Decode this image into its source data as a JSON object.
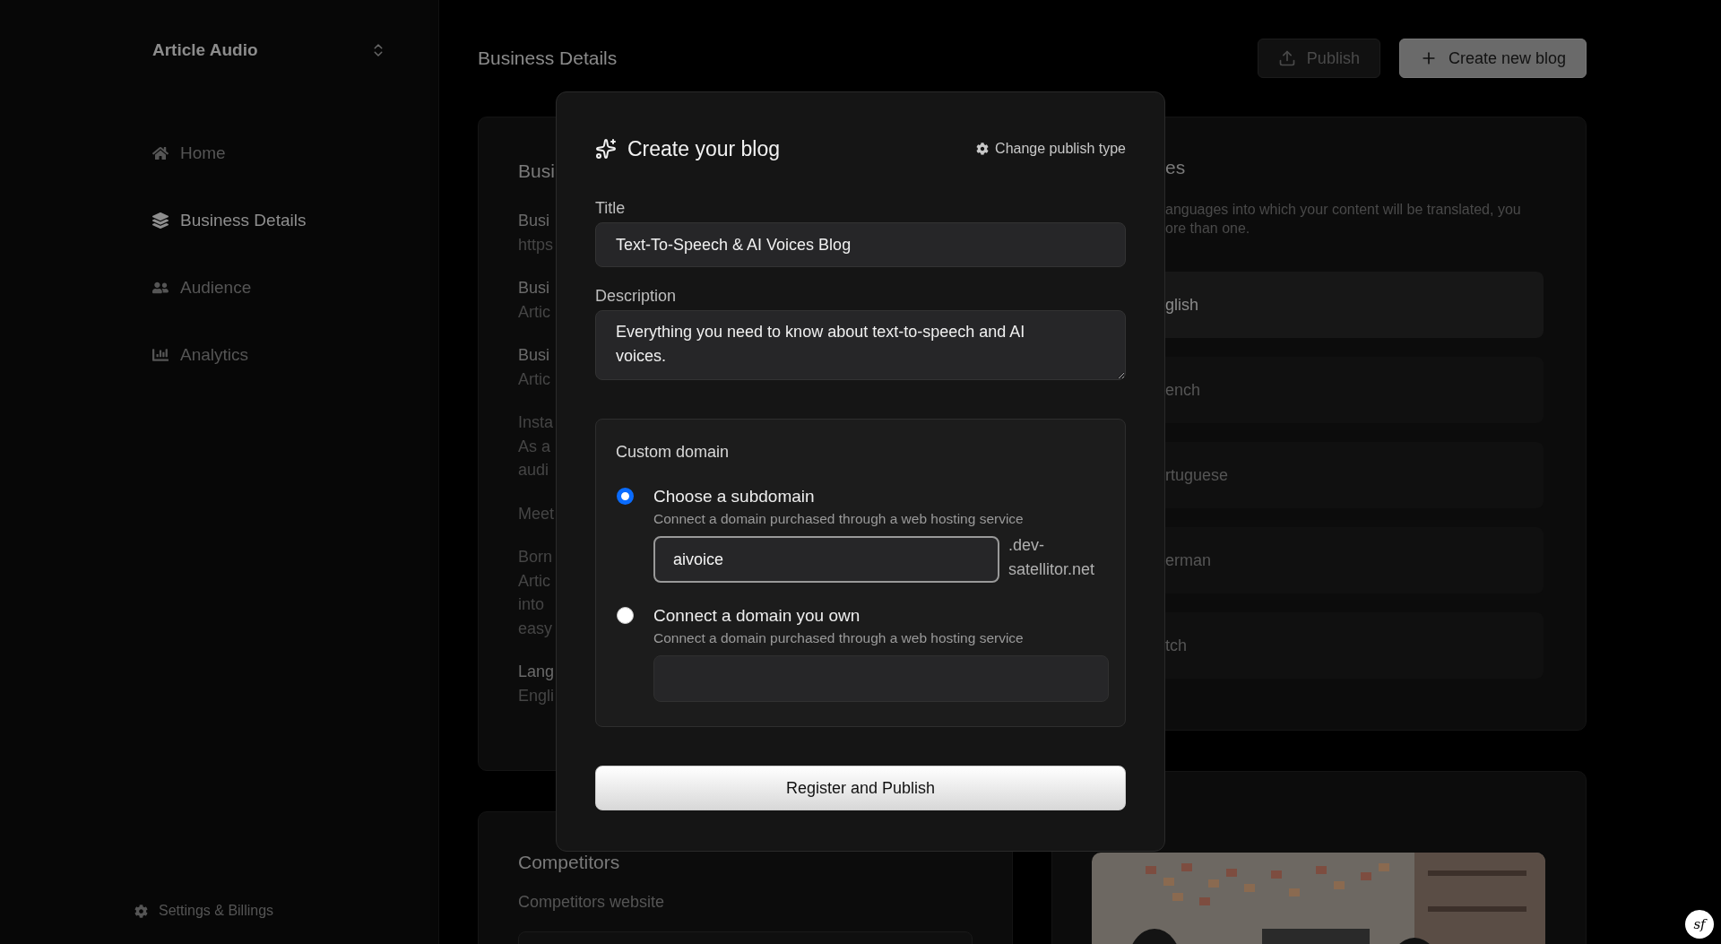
{
  "sidebar": {
    "title": "Article Audio",
    "items": [
      {
        "label": "Home",
        "selected": false
      },
      {
        "label": "Business Details",
        "selected": true
      },
      {
        "label": "Audience",
        "selected": false
      },
      {
        "label": "Analytics",
        "selected": false
      }
    ],
    "footer": "Settings & Billings"
  },
  "header": {
    "title": "Business Details",
    "buttons": [
      {
        "label": "Publish",
        "kind": "secondary"
      },
      {
        "label": "Create new blog",
        "kind": "primary"
      }
    ]
  },
  "business_card": {
    "heading": "Busi",
    "blocks": [
      {
        "kind": "field",
        "label": "Busi",
        "lines": [
          "https"
        ]
      },
      {
        "kind": "field",
        "label": "Busi",
        "lines": [
          "Artic"
        ]
      },
      {
        "kind": "field",
        "label": "Busi",
        "lines": [
          "Artic"
        ]
      },
      {
        "kind": "text",
        "lines": [
          "Insta",
          "As a",
          "audi"
        ]
      },
      {
        "kind": "text",
        "lines": [
          "Meet"
        ]
      },
      {
        "kind": "text",
        "lines": [
          "Born",
          "Artic",
          "into",
          "easy"
        ]
      },
      {
        "kind": "field",
        "label": "Lang",
        "lines": [
          "Engli"
        ]
      }
    ]
  },
  "competitors_card": {
    "heading": "Competitors",
    "label": "Competitors website"
  },
  "languages_card": {
    "heading": "es",
    "description": [
      "anguages into which your content will be translated, you",
      "ore than one."
    ],
    "languages": [
      {
        "label": "glish",
        "selected": true
      },
      {
        "label": "ench",
        "selected": false
      },
      {
        "label": "rtuguese",
        "selected": false
      },
      {
        "label": "erman",
        "selected": false
      },
      {
        "label": "tch",
        "selected": false
      }
    ]
  },
  "modal": {
    "title": "Create your blog",
    "action": "Change publish type",
    "title_field": {
      "label": "Title",
      "value": "Text-To-Speech & AI Voices Blog"
    },
    "description_field": {
      "label": "Description",
      "value": "Everything you need to know about text-to-speech and AI voices."
    },
    "domain": {
      "heading": "Custom domain",
      "options": [
        {
          "label": "Choose a subdomain",
          "hint": "Connect a domain purchased through a web hosting service",
          "selected": true,
          "value": "aivoice",
          "suffix": ".dev-satellitor.net"
        },
        {
          "label": "Connect a domain you own",
          "hint": "Connect a domain purchased through a web hosting service",
          "selected": false
        }
      ]
    },
    "submit": "Register and Publish"
  },
  "corner_badge": "sf"
}
